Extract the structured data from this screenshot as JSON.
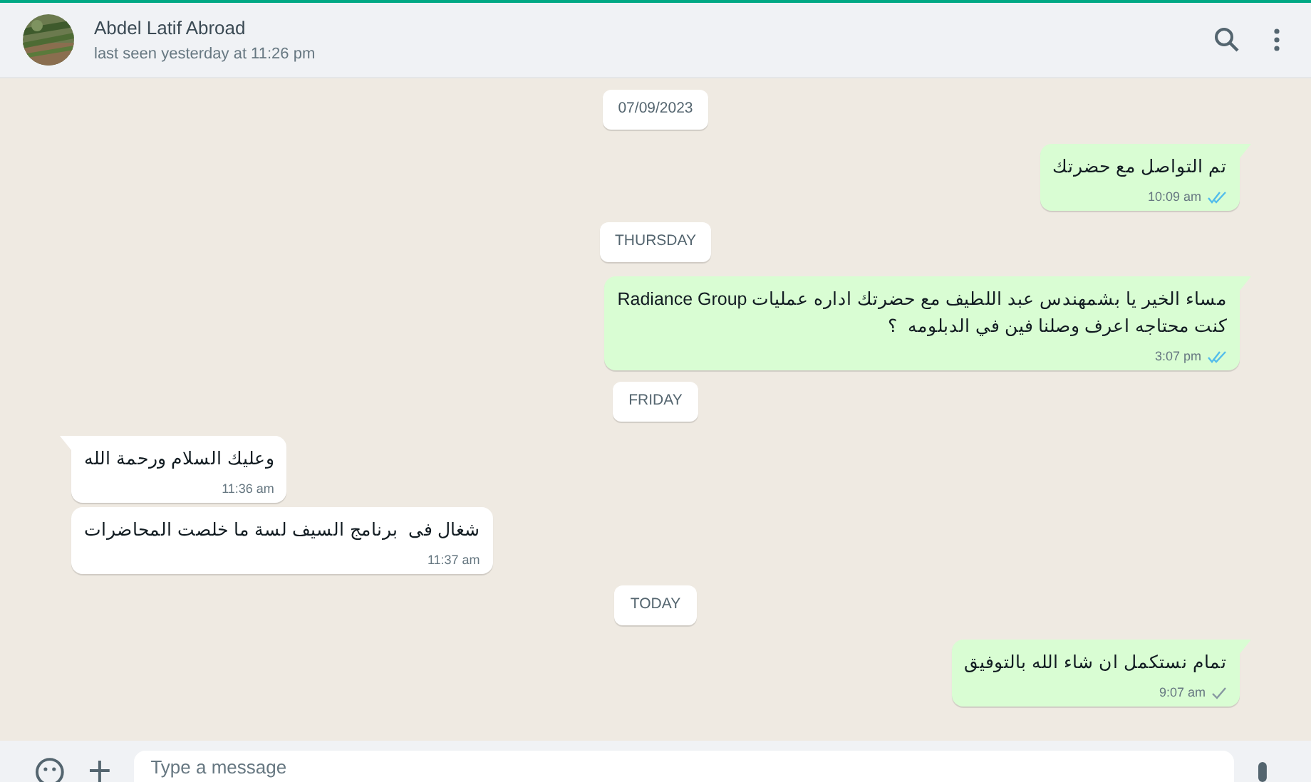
{
  "header": {
    "contact_name": "Abdel Latif Abroad",
    "status": "last seen yesterday at 11:26 pm"
  },
  "messages": [
    {
      "kind": "date",
      "text": "07/09/2023"
    },
    {
      "kind": "message",
      "outgoing": true,
      "tail": true,
      "text": "تم التواصل مع حضرتك",
      "time": "10:09 am",
      "read": true
    },
    {
      "kind": "date",
      "text": "THURSDAY"
    },
    {
      "kind": "message",
      "outgoing": true,
      "tail": true,
      "text": "مساء الخير يا بشمهندس عبد اللطيف مع حضرتك اداره عمليات Radiance Group\nكنت محتاجه اعرف وصلنا فين في الدبلومه  ؟",
      "time": "3:07 pm",
      "read": true
    },
    {
      "kind": "date",
      "text": "FRIDAY"
    },
    {
      "kind": "message",
      "outgoing": false,
      "tail": true,
      "text": "وعليك السلام ورحمة الله",
      "time": "11:36 am"
    },
    {
      "kind": "message",
      "outgoing": false,
      "tail": false,
      "text": "شغال فى  برنامج السيف لسة ما خلصت المحاضرات",
      "time": "11:37 am"
    },
    {
      "kind": "date",
      "text": "TODAY"
    },
    {
      "kind": "message",
      "outgoing": true,
      "tail": true,
      "text": "تمام نستكمل ان شاء الله بالتوفيق",
      "time": "9:07 am",
      "read": false
    }
  ],
  "composer": {
    "placeholder": "Type a message"
  }
}
